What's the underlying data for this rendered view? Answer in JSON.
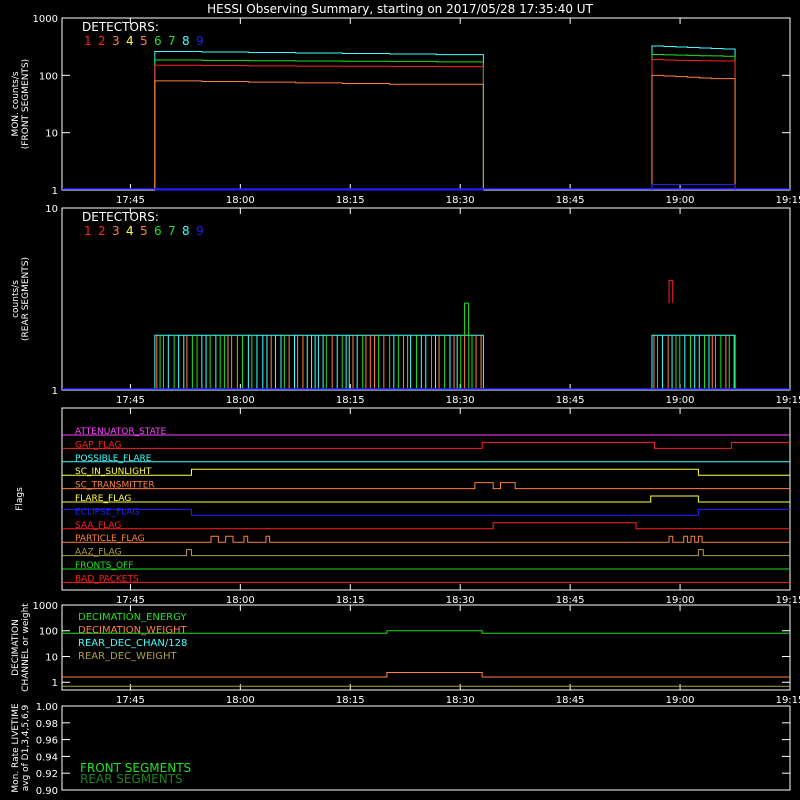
{
  "page_title": "HESSI Observing Summary, starting on 2017/05/28 17:35:40 UT",
  "colors": {
    "background": "#000000",
    "axes": "#ffffff",
    "red": "#ff2020",
    "orange": "#ff8040",
    "yellow": "#ffff40",
    "green": "#20e020",
    "cyan": "#40ffff",
    "blue": "#2020ff",
    "magenta": "#ff40ff",
    "olive": "#b0a040"
  },
  "chart_data": [
    {
      "id": "front",
      "type": "line",
      "ylabel": "MON. counts/s\n(FRONT SEGMENTS)",
      "scale": "log",
      "ylim": [
        1,
        1000
      ],
      "xlim": [
        "17:35:40",
        "19:15:00"
      ],
      "x_ticks": [
        "17:45",
        "18:00",
        "18:15",
        "18:30",
        "18:45",
        "19:00",
        "19:15"
      ],
      "y_ticks": [
        "1",
        "10",
        "100",
        "1000"
      ],
      "legend_title": "DETECTORS:",
      "detectors": [
        "1",
        "2",
        "3",
        "4",
        "5",
        "6",
        "7",
        "8",
        "9"
      ],
      "detector_colors": [
        "#ff2020",
        "#ff2020",
        "#ff8040",
        "#ffff40",
        "#ff8040",
        "#20e020",
        "#20e020",
        "#40ffff",
        "#2020ff"
      ],
      "data_segments": [
        [
          "17:48:20",
          "18:33:10"
        ],
        [
          "18:56:10",
          "19:07:30"
        ]
      ],
      "series": [
        {
          "color": "#40ffff",
          "values": [
            260,
            255,
            250,
            245,
            240,
            235,
            230
          ]
        },
        {
          "color": "#20e020",
          "values": [
            185,
            182,
            180,
            178,
            176,
            175,
            172
          ]
        },
        {
          "color": "#ff2020",
          "values": [
            150,
            148,
            146,
            145,
            144,
            143,
            142
          ]
        },
        {
          "color": "#ff8040",
          "values": [
            80,
            78,
            76,
            74,
            72,
            70,
            70
          ]
        },
        {
          "color": "#2020ff",
          "values": [
            1,
            1,
            1,
            1,
            1,
            1,
            1
          ]
        }
      ]
    },
    {
      "id": "rear",
      "type": "line",
      "ylabel": "counts/s\n(REAR SEGMENTS)",
      "scale": "log",
      "ylim": [
        1,
        10
      ],
      "x_ticks": [
        "17:45",
        "18:00",
        "18:15",
        "18:30",
        "18:45",
        "19:00",
        "19:15"
      ],
      "y_ticks": [
        "1",
        "10"
      ],
      "legend_title": "DETECTORS:",
      "detectors": [
        "1",
        "2",
        "3",
        "4",
        "5",
        "6",
        "7",
        "8",
        "9"
      ],
      "detector_colors": [
        "#ff2020",
        "#ff2020",
        "#ff8040",
        "#ffff40",
        "#ff8040",
        "#20e020",
        "#20e020",
        "#40ffff",
        "#2020ff"
      ],
      "levels": [
        1,
        2,
        3,
        4
      ]
    },
    {
      "id": "flags",
      "type": "line",
      "ylabel": "Flags",
      "x_ticks": [
        "17:45",
        "18:00",
        "18:15",
        "18:30",
        "18:45",
        "19:00",
        "19:15"
      ],
      "flags": [
        {
          "name": "ATTENUATOR_STATE",
          "color": "#ff40ff",
          "transitions": []
        },
        {
          "name": "GAP_FLAG",
          "color": "#ff2020",
          "transitions": [
            [
              "18:33:00",
              1
            ],
            [
              "18:56:30",
              0
            ],
            [
              "19:07:00",
              1
            ]
          ]
        },
        {
          "name": "POSSIBLE_FLARE",
          "color": "#40ffff",
          "transitions": []
        },
        {
          "name": "SC_IN_SUNLIGHT",
          "color": "#ffff40",
          "transitions": [
            [
              "17:53:20",
              1
            ],
            [
              "19:02:30",
              0
            ]
          ]
        },
        {
          "name": "SC_TRANSMITTER",
          "color": "#ff8040",
          "transitions": [
            [
              "18:32:00",
              1
            ],
            [
              "18:34:30",
              0
            ],
            [
              "18:35:30",
              1
            ],
            [
              "18:37:30",
              0
            ]
          ]
        },
        {
          "name": "FLARE_FLAG",
          "color": "#ffff40",
          "transitions": [
            [
              "18:56:00",
              1
            ],
            [
              "19:02:30",
              0
            ]
          ]
        },
        {
          "name": "ECLIPSE_FLAG",
          "color": "#2020ff",
          "transitions": [
            [
              "17:53:20",
              0
            ],
            [
              "19:02:30",
              1
            ]
          ]
        },
        {
          "name": "SAA_FLAG",
          "color": "#ff2020",
          "transitions": [
            [
              "18:34:30",
              1
            ],
            [
              "18:54:00",
              0
            ]
          ]
        },
        {
          "name": "PARTICLE_FLAG",
          "color": "#ff8040",
          "transitions": [
            [
              "17:56:00",
              1
            ],
            [
              "17:57:00",
              0
            ],
            [
              "17:58:00",
              1
            ],
            [
              "17:59:00",
              0
            ],
            [
              "18:00:30",
              1
            ],
            [
              "18:01:00",
              0
            ],
            [
              "18:03:30",
              1
            ],
            [
              "18:04:00",
              0
            ],
            [
              "18:53:00",
              0
            ],
            [
              "18:58:30",
              1
            ],
            [
              "18:59:00",
              0
            ],
            [
              "19:00:30",
              1
            ],
            [
              "19:01:00",
              0
            ],
            [
              "19:01:30",
              1
            ],
            [
              "19:02:00",
              0
            ],
            [
              "19:02:30",
              1
            ],
            [
              "19:03:00",
              0
            ]
          ]
        },
        {
          "name": "AAZ_FLAG",
          "color": "#b0a040",
          "transitions": [
            [
              "17:52:40",
              1
            ],
            [
              "17:53:20",
              0
            ],
            [
              "19:02:30",
              1
            ],
            [
              "19:03:10",
              0
            ]
          ]
        },
        {
          "name": "FRONTS_OFF",
          "color": "#20e020",
          "transitions": []
        },
        {
          "name": "BAD_PACKETS",
          "color": "#ff2020",
          "transitions": []
        }
      ]
    },
    {
      "id": "decimation",
      "type": "line",
      "ylabel": "DECIMATION\nCHANNEL or weight",
      "scale": "log",
      "ylim": [
        0.5,
        1000
      ],
      "x_ticks": [
        "17:45",
        "18:00",
        "18:15",
        "18:30",
        "18:45",
        "19:00",
        "19:15"
      ],
      "y_ticks": [
        "1",
        "10",
        "100",
        "1000"
      ],
      "series": [
        {
          "name": "DECIMATION_ENERGY",
          "color": "#20e020",
          "steps": [
            [
              "17:35:40",
              80
            ],
            [
              "18:20:00",
              100
            ],
            [
              "18:33:00",
              80
            ]
          ]
        },
        {
          "name": "DECIMATION_WEIGHT",
          "color": "#ff8040",
          "steps": [
            [
              "17:35:40",
              1.6
            ],
            [
              "18:20:00",
              2.4
            ],
            [
              "18:33:00",
              1.6
            ]
          ]
        },
        {
          "name": "REAR_DEC_CHAN/128",
          "color": "#40ffff",
          "steps": []
        },
        {
          "name": "REAR_DEC_WEIGHT",
          "color": "#b0a040",
          "steps": [
            [
              "17:35:40",
              0.7
            ]
          ]
        }
      ]
    },
    {
      "id": "livetime",
      "type": "line",
      "ylabel": "Mon. Rate LIVETIME\navg of D1,3,4,5,6,9",
      "ylim": [
        0.9,
        1.0
      ],
      "x_ticks": [],
      "y_ticks": [
        "0.90",
        "0.92",
        "0.94",
        "0.96",
        "0.98",
        "1.00"
      ],
      "legend": [
        {
          "name": "FRONT SEGMENTS",
          "color": "#20e020"
        },
        {
          "name": "REAR SEGMENTS",
          "color": "#208020"
        }
      ]
    }
  ]
}
